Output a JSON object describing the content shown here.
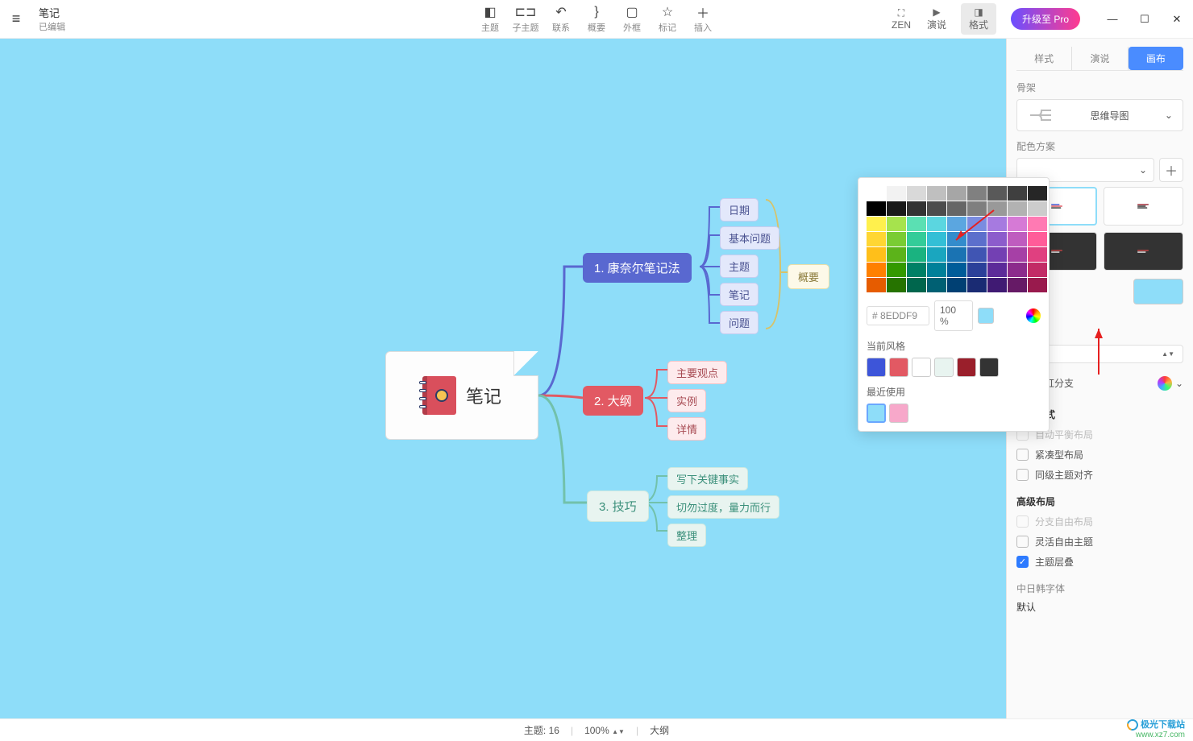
{
  "doc": {
    "title": "笔记",
    "status": "已编辑"
  },
  "toolbar": {
    "items": [
      {
        "icon": "topic-icon",
        "glyph": "◧",
        "label": "主题"
      },
      {
        "icon": "subtopic-icon",
        "glyph": "⊏⊐",
        "label": "子主题"
      },
      {
        "icon": "relation-icon",
        "glyph": "↶",
        "label": "联系"
      },
      {
        "icon": "summary-icon",
        "glyph": "}",
        "label": "概要"
      },
      {
        "icon": "boundary-icon",
        "glyph": "▢",
        "label": "外框"
      },
      {
        "icon": "marker-icon",
        "glyph": "☆",
        "label": "标记"
      },
      {
        "icon": "insert-icon",
        "glyph": "＋",
        "label": "插入"
      }
    ],
    "right": [
      {
        "icon": "zen-icon",
        "glyph": "⛶",
        "label": "ZEN"
      },
      {
        "icon": "present-icon",
        "glyph": "▶",
        "label": "演说"
      },
      {
        "icon": "format-icon",
        "glyph": "◨",
        "label": "格式"
      }
    ],
    "upgrade": "升级至 Pro"
  },
  "mindmap": {
    "root": "笔记",
    "branches": [
      {
        "label": "1. 康奈尔笔记法",
        "leaves": [
          "日期",
          "基本问题",
          "主题",
          "笔记",
          "问题"
        ],
        "summary": "概要"
      },
      {
        "label": "2. 大纲",
        "leaves": [
          "主要观点",
          "实例",
          "详情"
        ]
      },
      {
        "label": "3. 技巧",
        "leaves": [
          "写下关键事实",
          "切勿过度，量力而行",
          "整理"
        ]
      }
    ]
  },
  "panel": {
    "tabs": {
      "style": "样式",
      "present": "演说",
      "canvas": "画布"
    },
    "skeleton": {
      "label": "骨架",
      "value": "思维导图"
    },
    "scheme": {
      "label": "配色方案"
    },
    "rainbow_label": "彩虹分支",
    "map_style": {
      "label": "导图样式",
      "auto_balance": "自动平衡布局",
      "compact": "紧凑型布局",
      "align_sibling": "同级主题对齐"
    },
    "advanced": {
      "label": "高级布局",
      "free_branch": "分支自由布局",
      "free_topic": "灵活自由主题",
      "overlap": "主题层叠"
    },
    "cjk_font": {
      "label": "中日韩字体",
      "value": "默认"
    }
  },
  "color_popup": {
    "hex_prefix": "#",
    "hex": "8EDDF9",
    "opacity": "100 %",
    "current_style_label": "当前风格",
    "current_style": [
      "#3d55d9",
      "#e25963",
      "#ffffff",
      "#e8f4f0",
      "#9a1f2b",
      "#333333"
    ],
    "recent_label": "最近使用",
    "recent": [
      "#8eddf9",
      "#f7a8ca"
    ],
    "palette": [
      [
        "#ffffff",
        "#f2f2f2",
        "#d9d9d9",
        "#bfbfbf",
        "#a6a6a6",
        "#808080",
        "#595959",
        "#3f3f3f",
        "#262626"
      ],
      [
        "#000000",
        "#1a1a1a",
        "#333333",
        "#4d4d4d",
        "#666666",
        "#7f7f7f",
        "#999999",
        "#b2b2b2",
        "#cccccc"
      ],
      [
        "#fff04d",
        "#a6e34d",
        "#5be0b3",
        "#5bd6e0",
        "#5ba6e0",
        "#7a8ce0",
        "#a67ae0",
        "#d67ad6",
        "#ff7ab3"
      ],
      [
        "#ffd633",
        "#7acc33",
        "#33cc99",
        "#33bfd6",
        "#338ccc",
        "#5c6fcc",
        "#8c5ccc",
        "#bf5cbf",
        "#ff5c99"
      ],
      [
        "#ffbf1a",
        "#5cb31a",
        "#1ab380",
        "#1aa6bf",
        "#1a73b3",
        "#4055b3",
        "#7340b3",
        "#a640a6",
        "#e04080"
      ],
      [
        "#ff8000",
        "#339900",
        "#008066",
        "#008099",
        "#005c99",
        "#2b4099",
        "#5c2b99",
        "#8c2b8c",
        "#c22b66"
      ],
      [
        "#e65c00",
        "#267300",
        "#00664d",
        "#006073",
        "#004073",
        "#1a2b73",
        "#401a73",
        "#661a66",
        "#991a4d"
      ]
    ]
  },
  "statusbar": {
    "topics_label": "主题:",
    "topics_count": "16",
    "zoom": "100%",
    "mode": "大纲"
  },
  "watermark": {
    "line1": "极光下载站",
    "line2": "www.xz7.com"
  }
}
